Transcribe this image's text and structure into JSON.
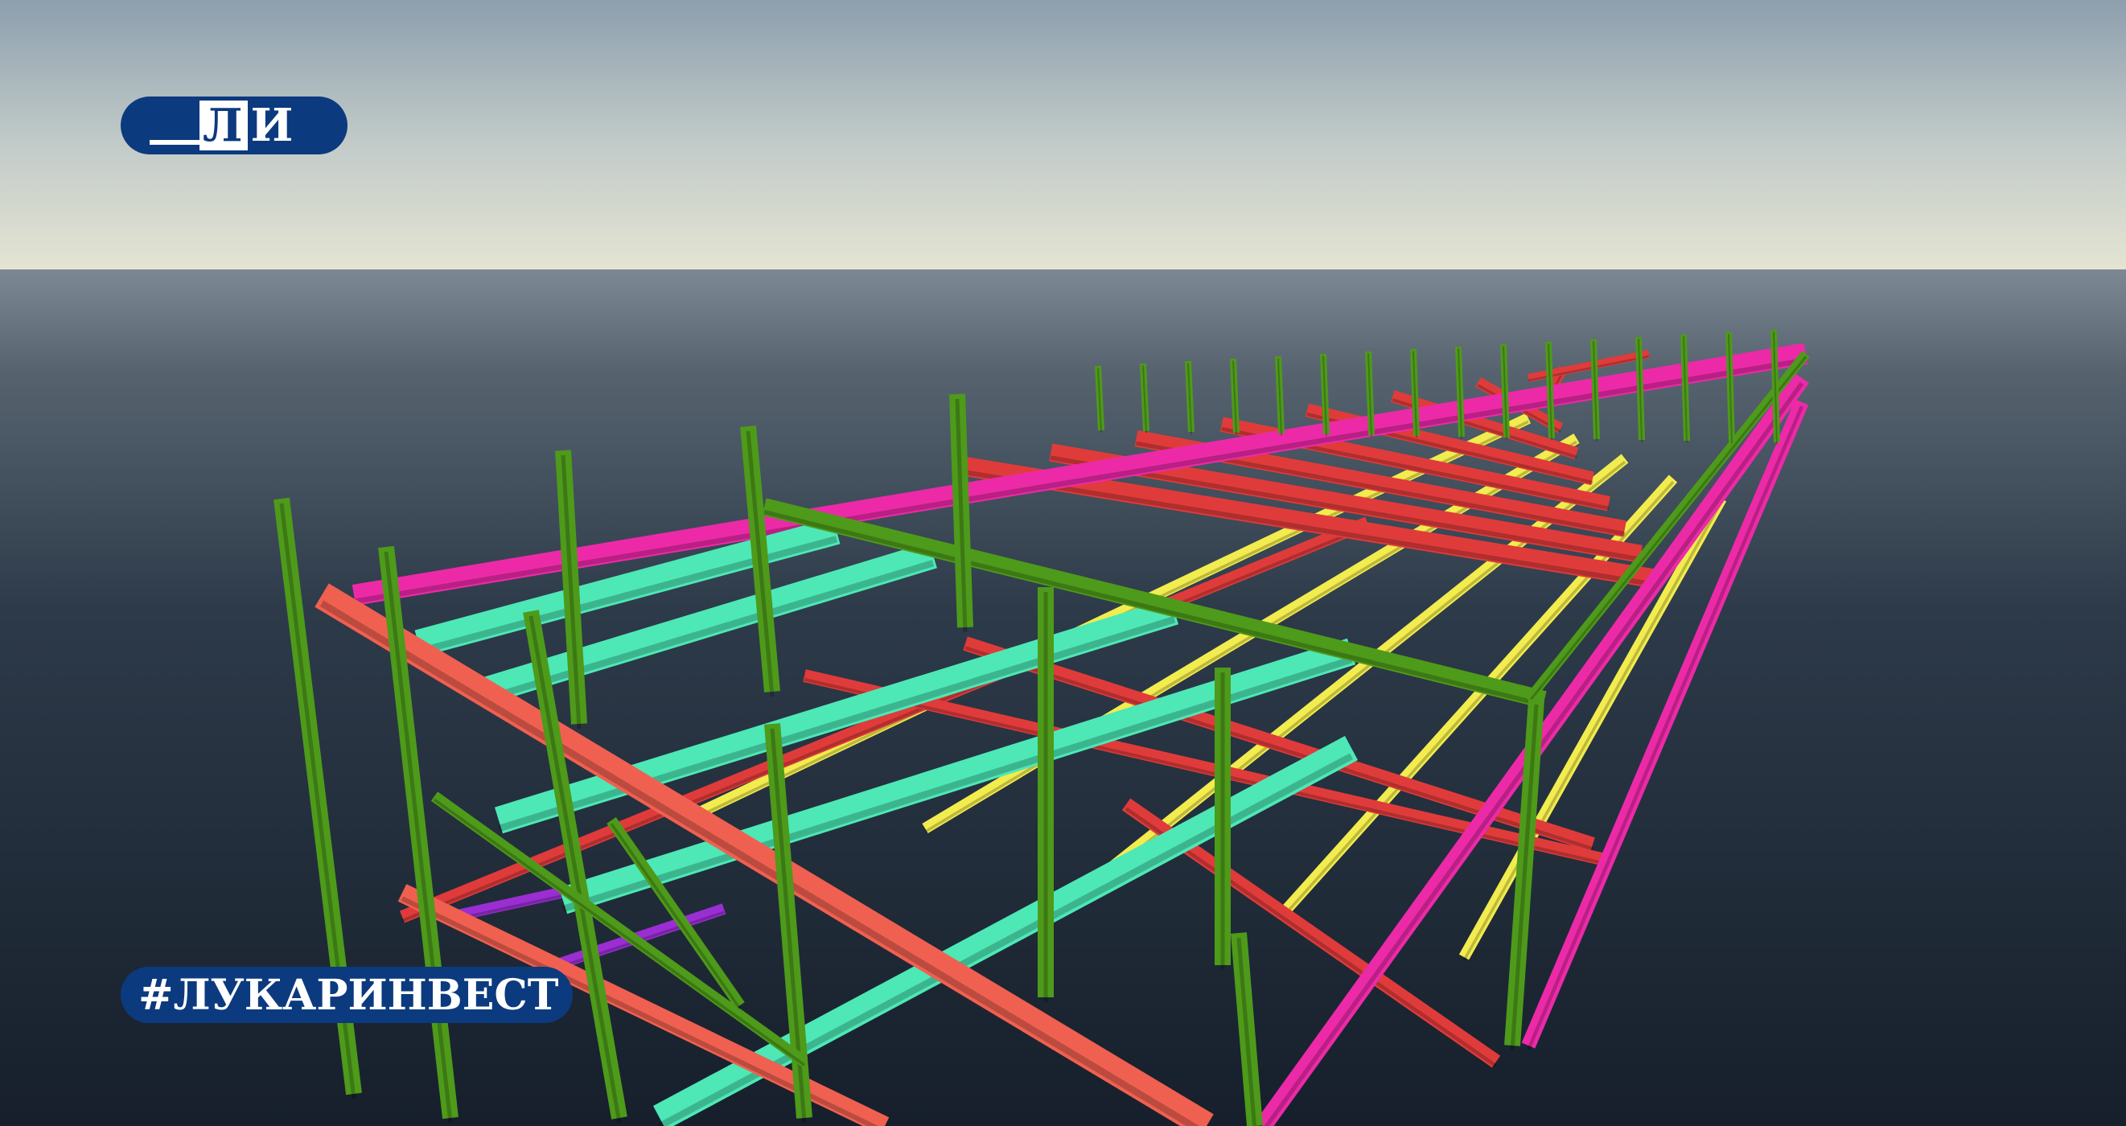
{
  "image": {
    "subject": "steel-frame-3d-model",
    "colors": {
      "sky_top": "#8c9eae",
      "sky_horizon": "#e2e3d2",
      "water_far": "#6d7a86",
      "water_near": "#1a2431",
      "columns": "#4e9a1a",
      "main_girders": "#f06050",
      "purlins_cyan": "#4de8b6",
      "purlins_magenta": "#ec2aa8",
      "purlins_yellow": "#f2ec4e",
      "beams_red": "#e03b3b",
      "braces_purple": "#9b2ed2",
      "badge": "#0c3a7f",
      "badge_text": "#ffffff"
    }
  },
  "logo": {
    "text_l": "Л",
    "text_i": "И"
  },
  "hashtag": {
    "text": "#ЛУКАРИНВЕСТ"
  }
}
